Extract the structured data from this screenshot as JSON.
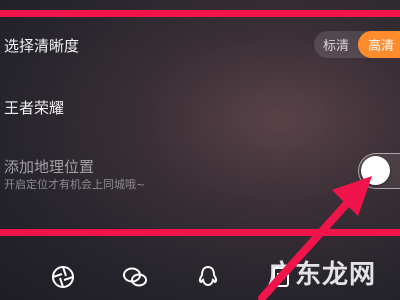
{
  "settings": {
    "quality_label": "选择清晰度",
    "quality_options": {
      "standard": "标清",
      "high": "高清"
    },
    "quality_selected": "高清",
    "game_label": "王者荣耀",
    "location_label": "添加地理位置",
    "location_hint": "开启定位才有机会上同城哦~",
    "location_toggle_on": false
  },
  "watermark": "广东龙网",
  "colors": {
    "highlight_bar": "#f0144a",
    "accent": "#ff8c2c",
    "arrow": "#f0144a"
  },
  "bottom_icons": [
    "camera-shutter-icon",
    "wechat-icon",
    "qq-icon",
    "document-icon"
  ]
}
